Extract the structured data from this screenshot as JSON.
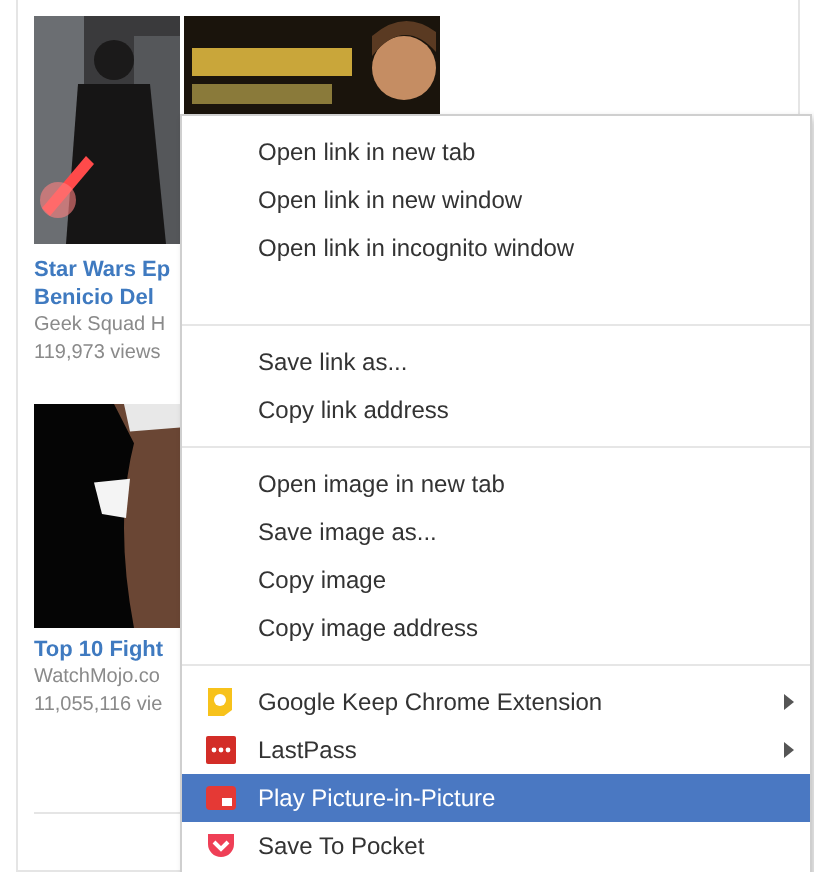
{
  "videos": [
    {
      "title_lines": [
        "Star Wars Ep",
        "Benicio Del"
      ],
      "channel": "Geek Squad H",
      "views": "119,973 views"
    },
    {
      "title_lines": [
        "Top 10 Fight"
      ],
      "channel": "WatchMojo.co",
      "views": "11,055,116 vie"
    }
  ],
  "context_menu": {
    "sections": [
      [
        {
          "label": "Open link in new tab",
          "kind": "text",
          "submenu": false,
          "selected": false
        },
        {
          "label": "Open link in new window",
          "kind": "text",
          "submenu": false,
          "selected": false
        },
        {
          "label": "Open link in incognito window",
          "kind": "text",
          "submenu": false,
          "selected": false
        }
      ],
      [
        {
          "label": "Save link as...",
          "kind": "text",
          "submenu": false,
          "selected": false
        },
        {
          "label": "Copy link address",
          "kind": "text",
          "submenu": false,
          "selected": false
        }
      ],
      [
        {
          "label": "Open image in new tab",
          "kind": "text",
          "submenu": false,
          "selected": false
        },
        {
          "label": "Save image as...",
          "kind": "text",
          "submenu": false,
          "selected": false
        },
        {
          "label": "Copy image",
          "kind": "text",
          "submenu": false,
          "selected": false
        },
        {
          "label": "Copy image address",
          "kind": "text",
          "submenu": false,
          "selected": false
        }
      ],
      [
        {
          "label": "Google Keep Chrome Extension",
          "kind": "keep",
          "submenu": true,
          "selected": false
        },
        {
          "label": "LastPass",
          "kind": "lastpass",
          "submenu": true,
          "selected": false
        },
        {
          "label": "Play Picture-in-Picture",
          "kind": "pip",
          "submenu": false,
          "selected": true
        },
        {
          "label": "Save To Pocket",
          "kind": "pocket",
          "submenu": false,
          "selected": false
        }
      ]
    ]
  }
}
